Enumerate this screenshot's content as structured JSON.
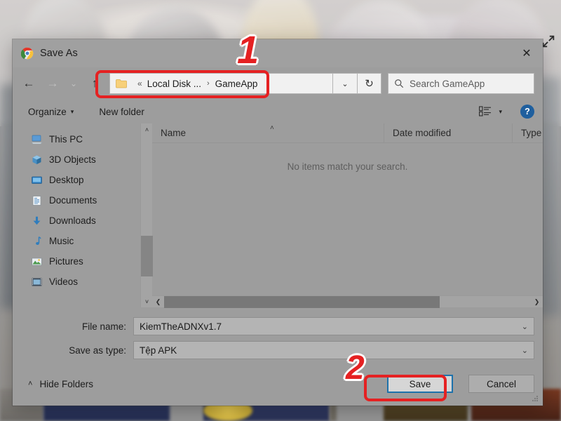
{
  "window": {
    "title": "Save As",
    "app_icon": "chrome-logo-icon",
    "close_label": "✕"
  },
  "navigation": {
    "back": "←",
    "forward": "→",
    "recent": "⌄",
    "up": "↑",
    "breadcrumb": {
      "folder_icon": "folder-icon",
      "prefix": "«",
      "parent": "Local Disk ...",
      "separator": "›",
      "current": "GameApp"
    },
    "dropdown_caret": "⌄",
    "refresh": "↻"
  },
  "search": {
    "icon": "search-icon",
    "placeholder": "Search GameApp",
    "value": ""
  },
  "toolbar": {
    "organize_label": "Organize",
    "organize_caret": "▾",
    "new_folder_label": "New folder",
    "view_icon": "view-list-icon",
    "view_caret": "▾",
    "help_label": "?"
  },
  "sidebar": {
    "items": [
      {
        "label": "This PC",
        "icon": "this-pc-icon"
      },
      {
        "label": "3D Objects",
        "icon": "3d-objects-icon"
      },
      {
        "label": "Desktop",
        "icon": "desktop-icon"
      },
      {
        "label": "Documents",
        "icon": "documents-icon"
      },
      {
        "label": "Downloads",
        "icon": "downloads-icon"
      },
      {
        "label": "Music",
        "icon": "music-icon"
      },
      {
        "label": "Pictures",
        "icon": "pictures-icon"
      },
      {
        "label": "Videos",
        "icon": "videos-icon"
      }
    ],
    "scroll_up": "˄",
    "scroll_down": "˅"
  },
  "filelist": {
    "columns": [
      "Name",
      "Date modified",
      "Type"
    ],
    "sort_indicator": "˄",
    "empty_message": "No items match your search.",
    "rows": [],
    "hscroll_left": "❮",
    "hscroll_right": "❯"
  },
  "form": {
    "filename_label": "File name:",
    "filename_value": "KiemTheADNXv1.7",
    "filetype_label": "Save as type:",
    "filetype_value": "Tệp APK",
    "caret": "⌄"
  },
  "footer": {
    "hide_folders_caret": "˄",
    "hide_folders_label": "Hide Folders",
    "save_label": "Save",
    "cancel_label": "Cancel"
  },
  "annotations": [
    {
      "number": "1",
      "target": "address-bar"
    },
    {
      "number": "2",
      "target": "save-button"
    }
  ],
  "page_behind": {
    "expand_icon": "expand-arrows-icon"
  },
  "colors": {
    "annotation_red": "#e52122",
    "focus_blue": "#1e72ab",
    "help_blue": "#1f5f9e",
    "dialog_bg": "#9d9d9d"
  }
}
